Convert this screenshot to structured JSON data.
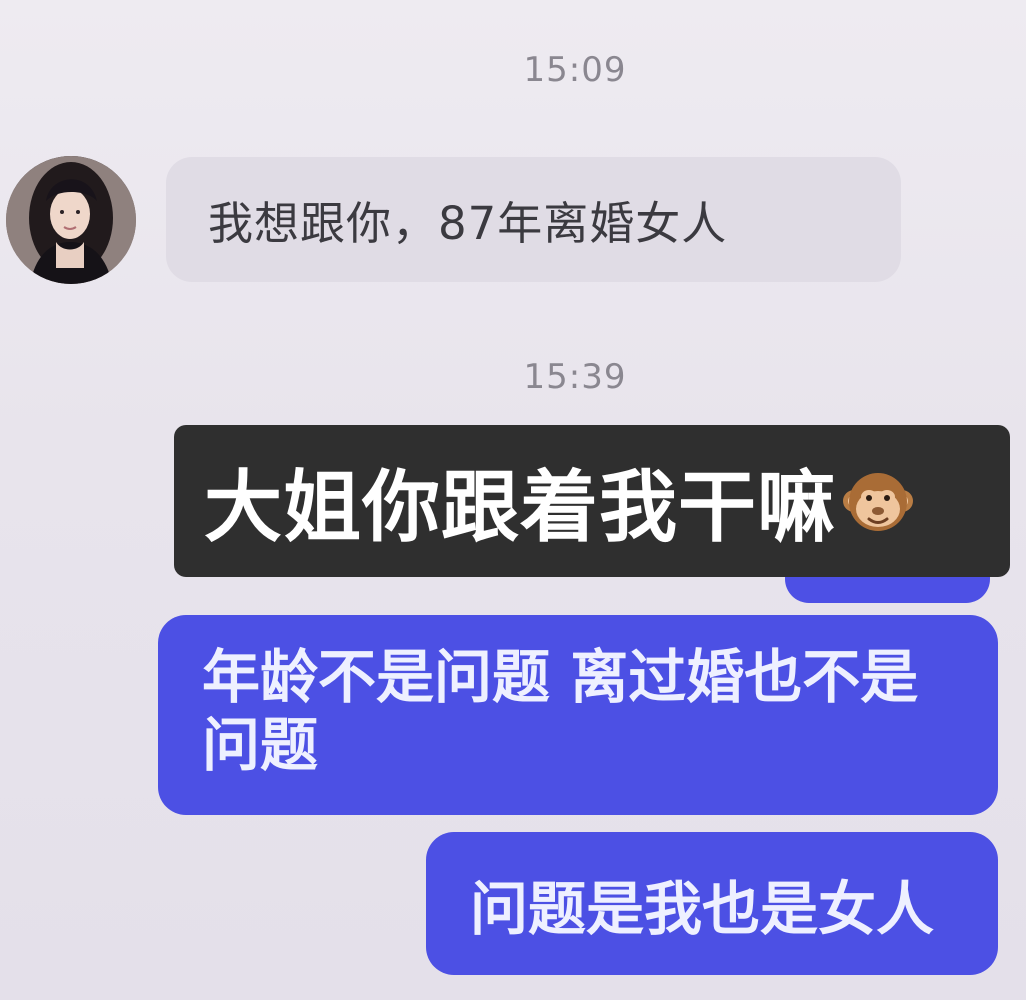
{
  "chat": {
    "timestamp_1": "15:09",
    "incoming_message": "我想跟你，87年离婚女人",
    "timestamp_2": "15:39",
    "overlay_caption": "大姐你跟着我干嘛",
    "overlay_caption_emoji": "monkey-face-icon",
    "outgoing_messages": [
      "年龄不是问题 离过婚也不是问题",
      "问题是我也是女人"
    ]
  },
  "colors": {
    "background": "#ebe7ef",
    "incoming_bubble": "#e0dce5",
    "outgoing_bubble": "#4c50e4",
    "caption_background": "#2f2f2f",
    "timestamp_text": "#8a8790"
  }
}
